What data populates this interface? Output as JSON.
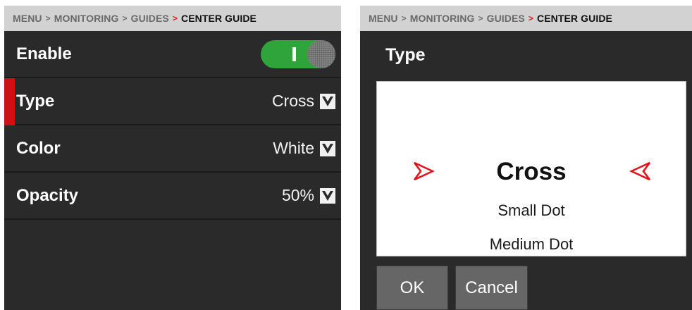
{
  "left_panel": {
    "breadcrumb": {
      "items": [
        "MENU",
        "MONITORING",
        "GUIDES"
      ],
      "current": "CENTER GUIDE",
      "separator": ">",
      "active_separator": ">"
    },
    "rows": {
      "enable": {
        "label": "Enable",
        "toggle_on": true
      },
      "type": {
        "label": "Type",
        "value": "Cross",
        "selected": true
      },
      "color": {
        "label": "Color",
        "value": "White"
      },
      "opacity": {
        "label": "Opacity",
        "value": "50%"
      }
    }
  },
  "right_panel": {
    "breadcrumb": {
      "items": [
        "MENU",
        "MONITORING",
        "GUIDES"
      ],
      "current": "CENTER GUIDE",
      "separator": ">",
      "active_separator": ">"
    },
    "title": "Type",
    "picker": {
      "selected": "Cross",
      "options": [
        "Small Dot",
        "Medium Dot"
      ]
    },
    "buttons": {
      "ok": "OK",
      "cancel": "Cancel"
    }
  },
  "colors": {
    "panel_bg": "#2a2a2a",
    "breadcrumb_bg": "#d2d2d2",
    "accent_red": "#cc1016",
    "toggle_green": "#2ea43a",
    "button_gray": "#666666"
  },
  "icons": {
    "dropdown": "chevron-down-icon",
    "picker_marker_left": "arrow-right-icon",
    "picker_marker_right": "arrow-left-icon"
  }
}
